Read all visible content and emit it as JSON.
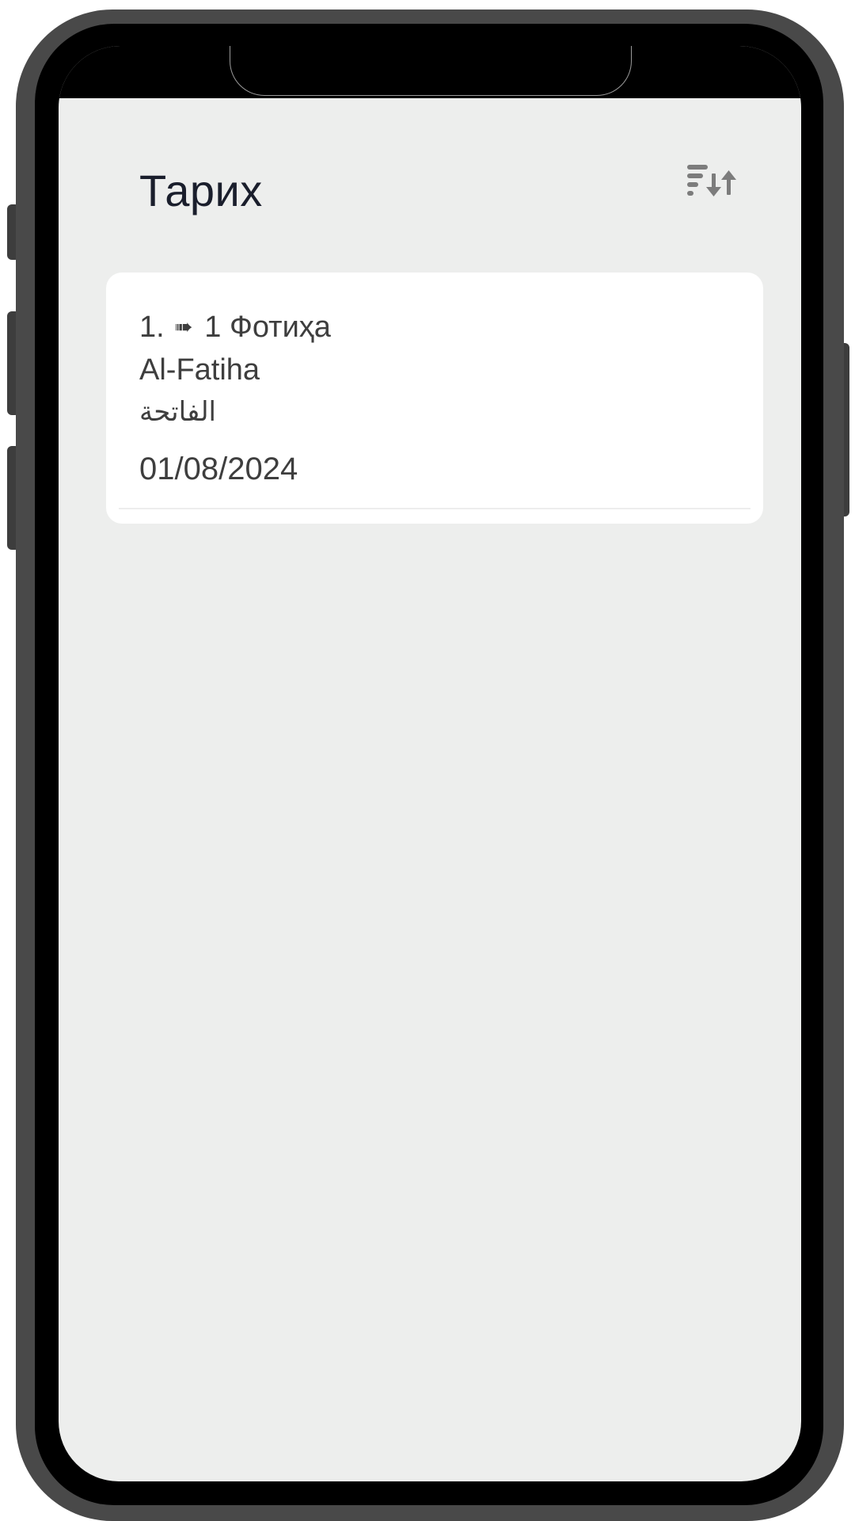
{
  "header": {
    "title": "Тарих",
    "sort_icon": "sort-icon"
  },
  "history": {
    "items": [
      {
        "index": "1.",
        "arrow_icon": "arrow-right-icon",
        "arrow_glyph": "➠",
        "surah": "1 Фотиҳа",
        "latin": "Al-Fatiha",
        "arabic": "الفاتحة",
        "date": "01/08/2024"
      }
    ]
  },
  "colors": {
    "screen_background": "#edeeed",
    "card_background": "#ffffff",
    "title_text": "#1a1e2c",
    "body_text": "#3e3e3e",
    "icon_gray": "#7c7c7c",
    "device_frame": "#494949"
  }
}
